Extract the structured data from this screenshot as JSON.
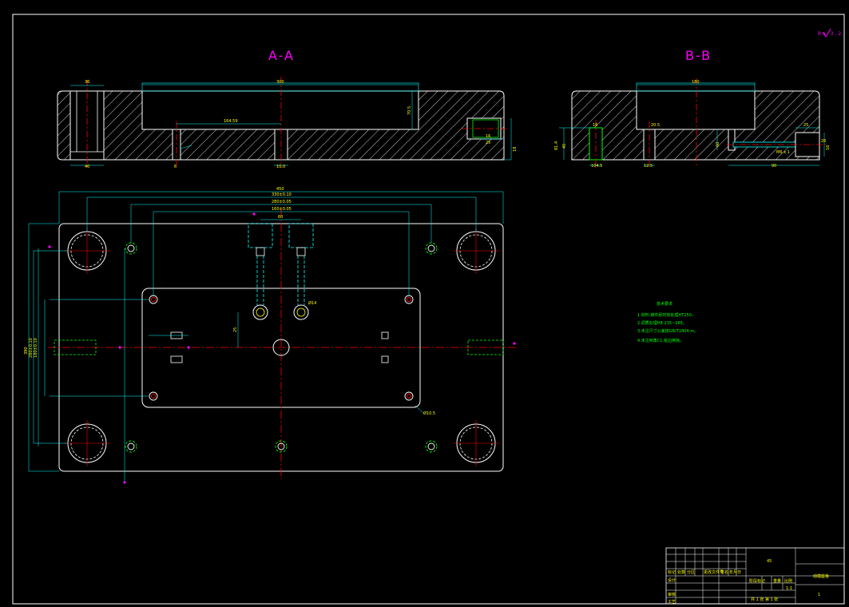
{
  "sections": {
    "section_a_title": "A-A",
    "section_b_title": "B-B"
  },
  "roughness_mark": "Ra 3.2",
  "dimensions": {
    "a_left_hole_width": "36",
    "a_top_width": "300",
    "a_left_bottom": "40",
    "a_inner_span": "164.59",
    "a_bottom_center": "10.0",
    "a_depth": "70.5",
    "a_small_left": "6",
    "a_right_1": "16",
    "a_right_2": "25",
    "a_right_3": "18",
    "b_top_width": "180",
    "b_height_1": "81.4",
    "b_height_2": "45",
    "b_left_hole": "16",
    "b_bottom_left": "104.5",
    "b_mid_1": "20.5",
    "b_mid_2": "12.5",
    "b_right_1": "25",
    "b_right_2": "90",
    "b_right_3": "60",
    "b_right_4": "16",
    "b_right_5": "26",
    "b_right_thread": "M6 x 1",
    "plan_overall": "450",
    "plan_2": "330±0.10",
    "plan_3": "280±0.05",
    "plan_4": "160±0.05",
    "plan_5": "60",
    "plan_side_1": "390",
    "plan_side_2": "280±0.10",
    "plan_side_3": "180±0.10",
    "plan_side_4": "25",
    "plan_hole_dia": "Ø14",
    "plan_plate": "Ø10.5"
  },
  "technical_requirements": {
    "heading": "技术要求",
    "items": [
      "1.材料:铸件经时效处理HT250。",
      "2.调质处理HB 235~265。",
      "3.未注尺寸公差按GB/T1804-m。",
      "4.未注倒角C1,锐边倒钝。"
    ]
  },
  "title_block": {
    "material": "45",
    "quantity": "1",
    "drawing_name": "动模座板",
    "scale_label": "比例",
    "scale_value": "1:1",
    "sheet_info": "共 1 张 第 1 张",
    "row_labels": [
      "标记",
      "设计",
      "审核",
      "工艺"
    ],
    "col_labels": [
      "处数",
      "分区",
      "更改文件号",
      "签名",
      "年月日"
    ],
    "stage_label": "阶段标记",
    "weight_label": "重量"
  },
  "colors": {
    "background": "#000000",
    "outline": "#ffffff",
    "hatch": "#ffffff",
    "centerline": "#ff0000",
    "dimension": "#00ffff",
    "dim_text": "#ffff00",
    "hidden": "#00ffff",
    "thread": "#00ff00",
    "title": "#ff00ff"
  }
}
